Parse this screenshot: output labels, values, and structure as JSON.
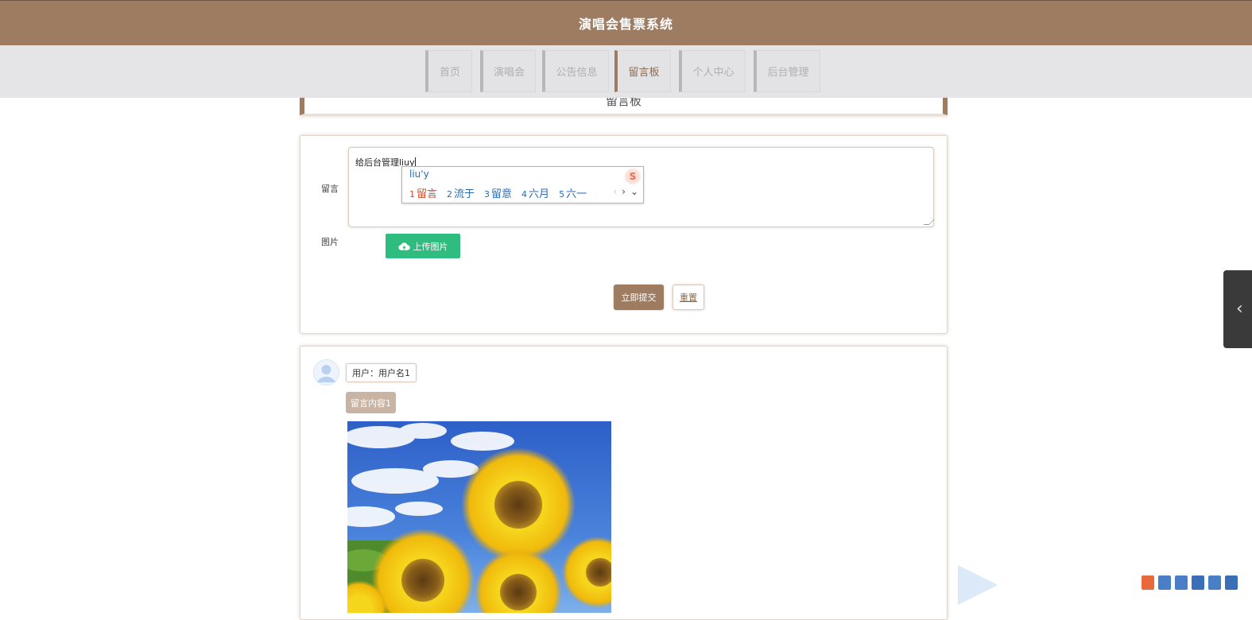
{
  "app": {
    "title": "演唱会售票系统"
  },
  "nav": {
    "items": [
      {
        "label": "首页",
        "active": false
      },
      {
        "label": "演唱会",
        "active": false
      },
      {
        "label": "公告信息",
        "active": false
      },
      {
        "label": "留言板",
        "active": true
      },
      {
        "label": "个人中心",
        "active": false
      },
      {
        "label": "后台管理",
        "active": false
      }
    ]
  },
  "board": {
    "title": "留言板"
  },
  "form": {
    "message_label": "留言",
    "message_value": "给后台管理liuy",
    "image_label": "图片",
    "upload_label": "上传图片",
    "submit_label": "立即提交",
    "reset_label": "重置"
  },
  "ime": {
    "input": "liu'y",
    "candidates": [
      {
        "num": "1",
        "text": "留言"
      },
      {
        "num": "2",
        "text": "流于"
      },
      {
        "num": "3",
        "text": "留意"
      },
      {
        "num": "4",
        "text": "六月"
      },
      {
        "num": "5",
        "text": "六一"
      }
    ]
  },
  "messages": [
    {
      "user": "用户：用户名1",
      "content": "留言内容1",
      "image": "sunflower-photo"
    }
  ],
  "colors": {
    "brand": "#9e7c62",
    "nav_bg": "#e5e4e6",
    "upload_green": "#2ebd7e",
    "content_tag": "#c9b4a3",
    "ime_blue": "#2a6ab8",
    "ime_red": "#d04a2a"
  },
  "icons": {
    "upload": "cloud-upload-icon",
    "avatar": "user-avatar-icon",
    "side_tab": "chevron-left-icon",
    "resize": "resize-grip-icon"
  }
}
